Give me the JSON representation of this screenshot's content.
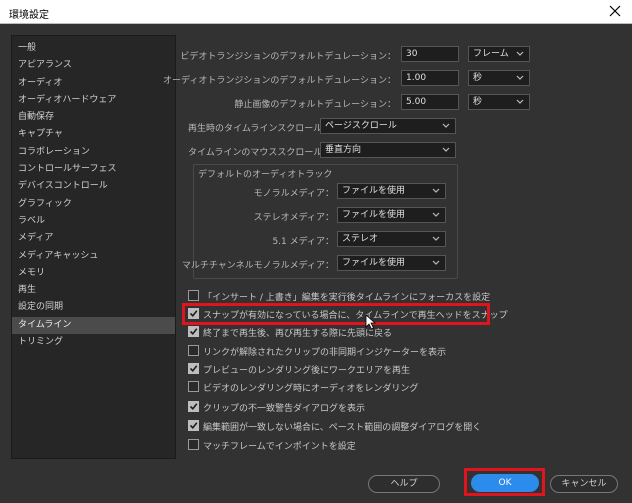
{
  "window": {
    "title": "環境設定"
  },
  "sidebar": {
    "items": [
      "一般",
      "アピアランス",
      "オーディオ",
      "オーディオハードウェア",
      "自動保存",
      "キャプチャ",
      "コラボレーション",
      "コントロールサーフェス",
      "デバイスコントロール",
      "グラフィック",
      "ラベル",
      "メディア",
      "メディアキャッシュ",
      "メモリ",
      "再生",
      "設定の同期",
      "タイムライン",
      "トリミング"
    ],
    "active_index": 16
  },
  "durations": {
    "video": {
      "label": "ビデオトランジションのデフォルトデュレーション：",
      "value": "30",
      "unit": "フレーム"
    },
    "audio": {
      "label": "オーディオトランジションのデフォルトデュレーション：",
      "value": "1.00",
      "unit": "秒"
    },
    "still": {
      "label": "静止画像のデフォルトデュレーション：",
      "value": "5.00",
      "unit": "秒"
    }
  },
  "scroll": {
    "playback": {
      "label": "再生時のタイムラインスクロール：",
      "value": "ページスクロール"
    },
    "mouse": {
      "label": "タイムラインのマウススクロール：",
      "value": "垂直方向"
    }
  },
  "audio_track": {
    "title": "デフォルトのオーディオトラック",
    "mono": {
      "label": "モノラルメディア：",
      "value": "ファイルを使用"
    },
    "stereo": {
      "label": "ステレオメディア：",
      "value": "ファイルを使用"
    },
    "surround": {
      "label": "5.1 メディア：",
      "value": "ステレオ"
    },
    "multi": {
      "label": "マルチチャンネルモノラルメディア：",
      "value": "ファイルを使用"
    }
  },
  "options": [
    {
      "label": "「インサート / 上書き」編集を実行後タイムラインにフォーカスを設定",
      "checked": false
    },
    {
      "label": "スナップが有効になっている場合に、タイムラインで再生ヘッドをスナップ",
      "checked": true
    },
    {
      "label": "終了まで再生後、再び再生する際に先頭に戻る",
      "checked": true
    },
    {
      "label": "リンクが解除されたクリップの非同期インジケーターを表示",
      "checked": false
    },
    {
      "label": "プレビューのレンダリング後にワークエリアを再生",
      "checked": true
    },
    {
      "label": "ビデオのレンダリング時にオーディオをレンダリング",
      "checked": false
    },
    {
      "label": "クリップの不一致警告ダイアログを表示",
      "checked": true
    },
    {
      "label": "編集範囲が一致しない場合に、ペースト範囲の調整ダイアログを開く",
      "checked": true
    },
    {
      "label": "マッチフレームでインポイントを設定",
      "checked": false
    }
  ],
  "buttons": {
    "help": "ヘルプ",
    "ok": "OK",
    "cancel": "キャンセル"
  },
  "colors": {
    "highlight": "#e0141e",
    "primary": "#2d8ceb"
  }
}
